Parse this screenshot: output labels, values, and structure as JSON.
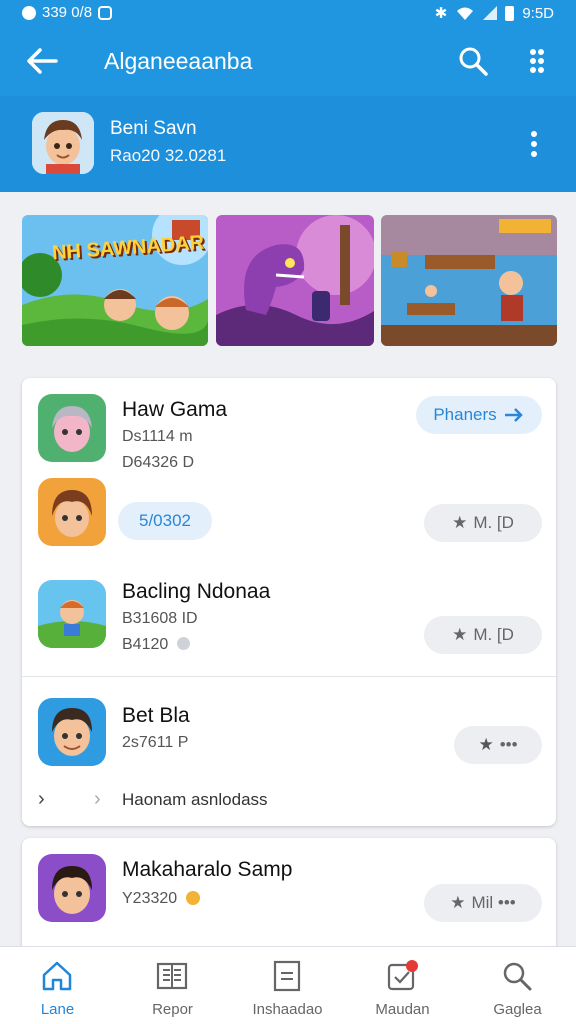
{
  "status_bar": {
    "time_left": "339 0/8",
    "time_right": "9:5D"
  },
  "app_bar": {
    "title": "Alganeeaanba",
    "back_icon": "arrow-left-icon",
    "search_icon": "search-icon",
    "more_icon": "more-vert-icon"
  },
  "profile": {
    "name": "Beni Savn",
    "subtitle": "Rao20 32.0281"
  },
  "banners": [
    {
      "title": "NH SAWNADAR"
    },
    {
      "title": ""
    },
    {
      "title": ""
    }
  ],
  "list": {
    "items": [
      {
        "title": "Haw Gama",
        "line1": "Ds1114 m",
        "line2": "D64326 D",
        "action": "Phaners"
      },
      {
        "chip": "5/0302",
        "action": "M. [D"
      },
      {
        "title": "Bacling Ndonaa",
        "line1": "B31608 ID",
        "line2": "B4120",
        "action": "M. [D"
      },
      {
        "title": "Bet Bla",
        "line1": "2s7611 P",
        "action": "*"
      },
      {
        "footer": "Haonam asnlodass"
      }
    ]
  },
  "card2": {
    "title": "Makaharalo Samp",
    "line1": "Y23320",
    "action": "Mil •••"
  },
  "bottom_nav": [
    {
      "label": "Lane",
      "icon": "home-icon",
      "active": true
    },
    {
      "label": "Repor",
      "icon": "report-icon",
      "active": false
    },
    {
      "label": "Inshaadao",
      "icon": "document-icon",
      "active": false
    },
    {
      "label": "Maudan",
      "icon": "notification-icon",
      "active": false
    },
    {
      "label": "Gaglea",
      "icon": "search-icon",
      "active": false
    }
  ],
  "colors": {
    "primary": "#2196e0",
    "accent": "#1f86d9",
    "background": "#eef0f3"
  }
}
